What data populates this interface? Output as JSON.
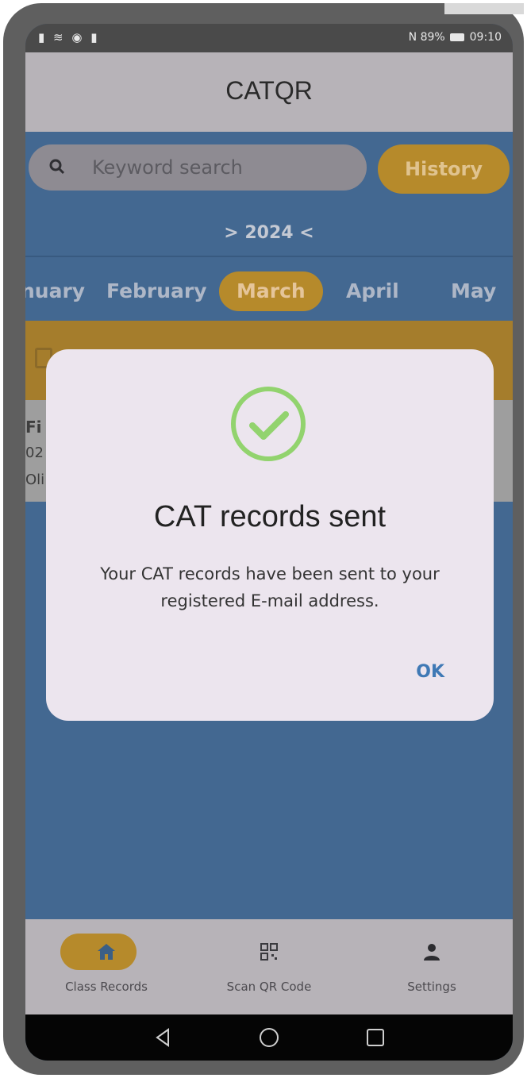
{
  "statusbar": {
    "left_icons": "▮ ≋ ◉ ▮",
    "right": "89%",
    "time": "09:10"
  },
  "appbar": {
    "title": "CATQR"
  },
  "search": {
    "placeholder": "Keyword search"
  },
  "history_button": "History",
  "year_selector": "> 2024 <",
  "months": [
    "nuary",
    "February",
    "March",
    "April",
    "May"
  ],
  "active_month": "March",
  "partial_list": {
    "line1": "Fi",
    "line2": "02",
    "line3": "Oli"
  },
  "dialog": {
    "title": "CAT records sent",
    "message_line1": "Your CAT records have been sent to your",
    "message_line2": "registered E-mail address.",
    "ok": "OK",
    "check_color": "#92d36e"
  },
  "bottom_nav": {
    "class_records": "Class Records",
    "scan_qr": "Scan QR Code",
    "settings": "Settings"
  },
  "colors": {
    "accent": "#b68a2b",
    "primary_bg": "#436891",
    "ok_blue": "#3f79b5"
  }
}
